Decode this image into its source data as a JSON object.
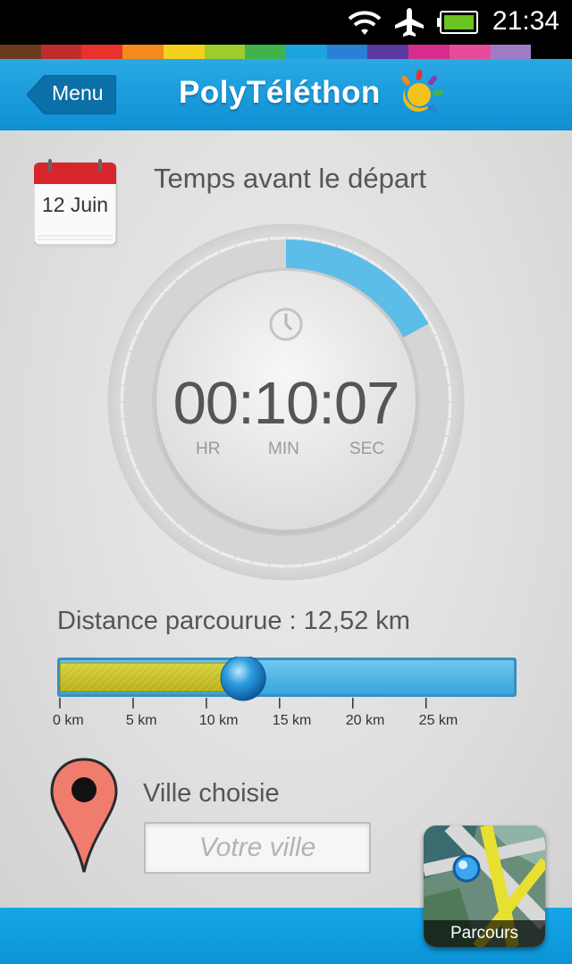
{
  "status_bar": {
    "time": "21:34",
    "icons": [
      "wifi-icon",
      "airplane-mode-icon",
      "battery-icon"
    ]
  },
  "color_strip": [
    "#6b3a1e",
    "#c02b2b",
    "#e8322b",
    "#f28a1c",
    "#f4d21c",
    "#9fcb2d",
    "#3fb44a",
    "#1aa5e0",
    "#2a7fd6",
    "#5a3aa0",
    "#d62d8c",
    "#e84a9a",
    "#a07cc8",
    "#000000"
  ],
  "header": {
    "menu_label": "Menu",
    "app_title": "PolyTéléthon",
    "accent": "#1a9ddc"
  },
  "calendar": {
    "date": "12 Juin"
  },
  "countdown": {
    "heading": "Temps avant le départ",
    "value": "00:10:07",
    "units": {
      "hr": "HR",
      "min": "MIN",
      "sec": "SEC"
    },
    "progress_fraction": 0.17,
    "progress_color": "#5bbde8"
  },
  "distance": {
    "label": "Distance parcourue : 12,52 km",
    "value_km": 12.52,
    "max_km": 31,
    "ticks": [
      "0 km",
      "5 km",
      "10 km",
      "15 km",
      "20 km",
      "25 km"
    ],
    "fill_color": "#c9c21e",
    "track_color": "#4fb7e6"
  },
  "city": {
    "label": "Ville choisie",
    "placeholder": "Votre ville",
    "value": ""
  },
  "route_button": {
    "label": "Parcours"
  }
}
